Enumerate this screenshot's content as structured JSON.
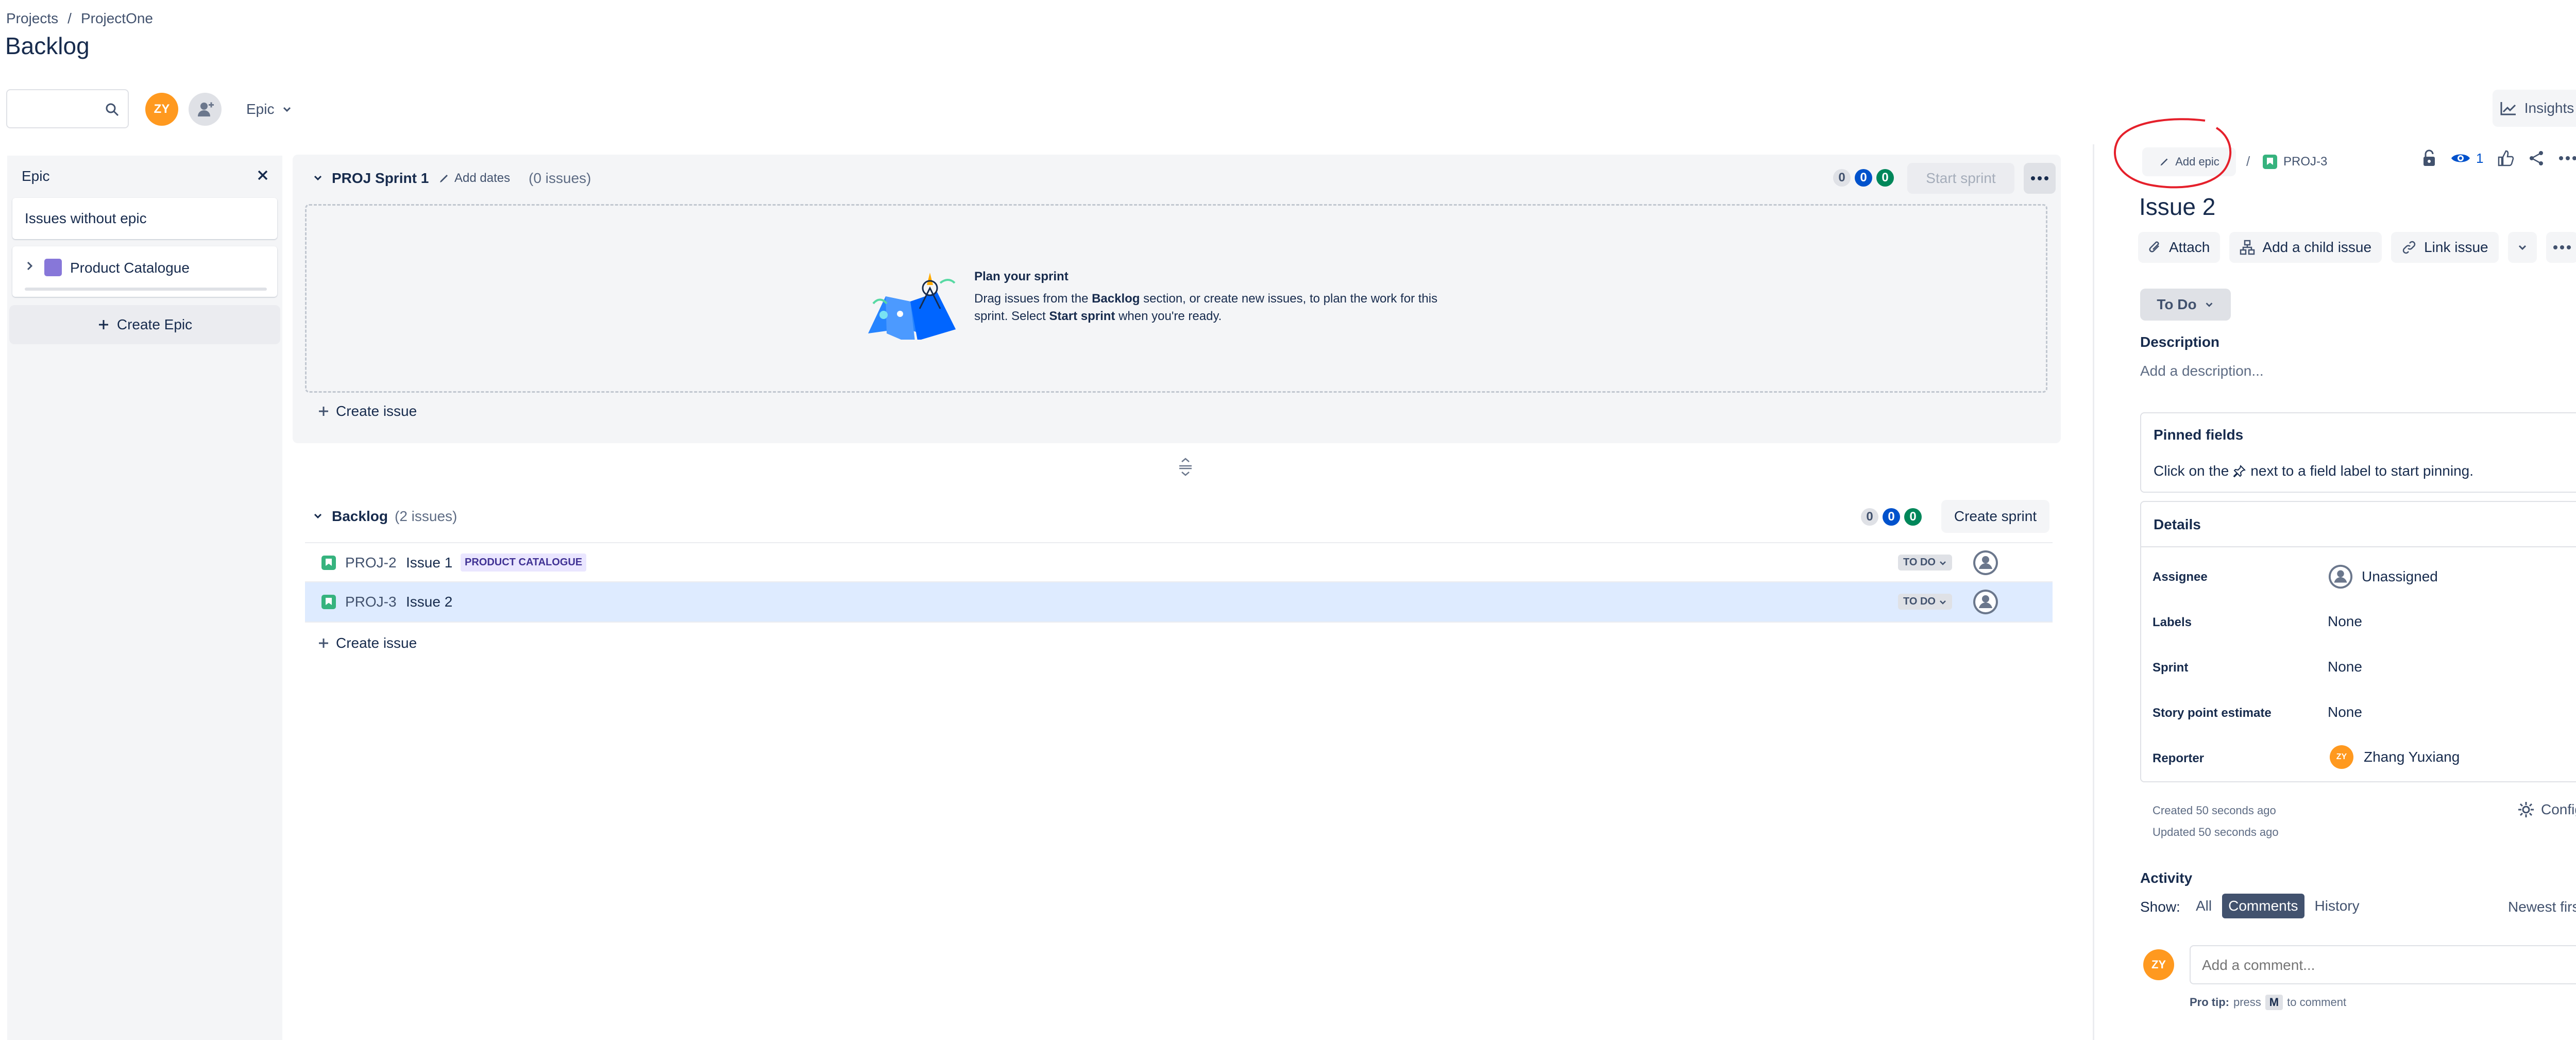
{
  "breadcrumb": {
    "projects": "Projects",
    "separator": "/",
    "project": "ProjectOne"
  },
  "page_title": "Backlog",
  "toolbar": {
    "search_placeholder": "",
    "user_initials": "ZY",
    "epic_filter_label": "Epic",
    "insights_label": "Insights"
  },
  "epic_panel": {
    "title": "Epic",
    "issues_without_epic": "Issues without epic",
    "epics": [
      {
        "name": "Product Catalogue",
        "color": "#8777d9"
      }
    ],
    "create_epic_label": "Create Epic"
  },
  "sprint": {
    "name": "PROJ Sprint 1",
    "add_dates_label": "Add dates",
    "issue_count": "(0 issues)",
    "counts": [
      "0",
      "0",
      "0"
    ],
    "start_button": "Start sprint",
    "empty_title": "Plan your sprint",
    "empty_text_1": "Drag issues from the ",
    "empty_text_bold_1": "Backlog",
    "empty_text_2": " section, or create new issues, to plan the work for this",
    "empty_text_3": "sprint. Select ",
    "empty_text_bold_2": "Start sprint",
    "empty_text_4": " when you're ready.",
    "create_issue_label": "Create issue"
  },
  "backlog": {
    "name": "Backlog",
    "issue_count": "(2 issues)",
    "counts": [
      "0",
      "0",
      "0"
    ],
    "create_sprint_button": "Create sprint",
    "issues": [
      {
        "key": "PROJ-2",
        "summary": "Issue 1",
        "epic": "PRODUCT CATALOGUE",
        "status": "TO DO"
      },
      {
        "key": "PROJ-3",
        "summary": "Issue 2",
        "epic": "",
        "status": "TO DO"
      }
    ],
    "create_issue_label": "Create issue"
  },
  "detail": {
    "add_epic_label": "Add epic",
    "separator": "/",
    "issue_key": "PROJ-3",
    "watch_count": "1",
    "title": "Issue 2",
    "attach_label": "Attach",
    "add_child_label": "Add a child issue",
    "link_issue_label": "Link issue",
    "status_label": "To Do",
    "description_heading": "Description",
    "description_placeholder": "Add a description...",
    "pinned": {
      "title": "Pinned fields",
      "text_before": "Click on the",
      "text_after": "next to a field label to start pinning."
    },
    "details_title": "Details",
    "fields": {
      "assignee_label": "Assignee",
      "assignee_value": "Unassigned",
      "labels_label": "Labels",
      "labels_value": "None",
      "sprint_label": "Sprint",
      "sprint_value": "None",
      "story_points_label": "Story point estimate",
      "story_points_value": "None",
      "reporter_label": "Reporter",
      "reporter_value": "Zhang Yuxiang",
      "reporter_initials": "ZY"
    },
    "created": "Created 50 seconds ago",
    "updated": "Updated 50 seconds ago",
    "configure_label": "Configure",
    "activity": {
      "heading": "Activity",
      "show_label": "Show:",
      "filters": [
        "All",
        "Comments",
        "History"
      ],
      "active_filter": "Comments",
      "sort_label": "Newest first",
      "comment_placeholder": "Add a comment...",
      "user_initials": "ZY",
      "pro_tip_prefix": "Pro tip:",
      "pro_tip_press": "press",
      "pro_tip_key": "M",
      "pro_tip_suffix": "to comment"
    }
  },
  "colors": {
    "accent": "#0052cc",
    "done_green": "#00875a",
    "avatar_orange": "#ff991f",
    "selected_row": "#deebff",
    "annotation_red": "#e5202b"
  }
}
